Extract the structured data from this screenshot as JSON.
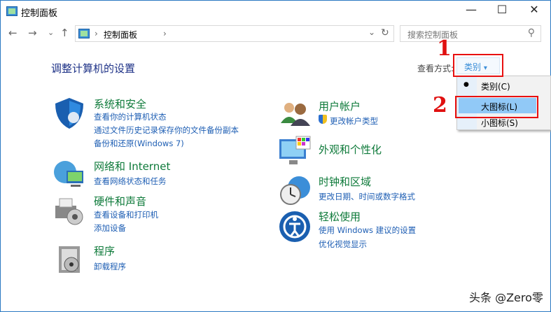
{
  "window": {
    "title": "控制面板",
    "minimize": "—",
    "maximize": "☐",
    "close": "✕"
  },
  "nav": {
    "back": "←",
    "forward": "→",
    "recent": "⌄",
    "up": "↑",
    "breadcrumb": "控制面板",
    "sep": "›",
    "dropdown": "⌄",
    "refresh": "↻"
  },
  "search": {
    "placeholder": "搜索控制面板",
    "icon": "⚲"
  },
  "heading": "调整计算机的设置",
  "view": {
    "label": "查看方式:",
    "value": "类别",
    "arrow": "▾"
  },
  "menu": {
    "bullet": "●",
    "items": [
      "类别(C)",
      "大图标(L)",
      "小图标(S)"
    ]
  },
  "annotations": {
    "one": "1",
    "two": "2"
  },
  "categories": [
    {
      "title": "系统和安全",
      "links": [
        "查看你的计算机状态",
        "通过文件历史记录保存你的文件备份副本",
        "备份和还原(Windows 7)"
      ]
    },
    {
      "title": "网络和 Internet",
      "links": [
        "查看网络状态和任务"
      ]
    },
    {
      "title": "硬件和声音",
      "links": [
        "查看设备和打印机",
        "添加设备"
      ]
    },
    {
      "title": "程序",
      "links": [
        "卸载程序"
      ]
    },
    {
      "title": "用户帐户",
      "links": [
        "更改帐户类型"
      ]
    },
    {
      "title": "外观和个性化",
      "links": []
    },
    {
      "title": "时钟和区域",
      "links": [
        "更改日期、时间或数字格式"
      ]
    },
    {
      "title": "轻松使用",
      "links": [
        "使用 Windows 建议的设置",
        "优化视觉显示"
      ]
    }
  ],
  "watermark": "头条 @Zero零"
}
